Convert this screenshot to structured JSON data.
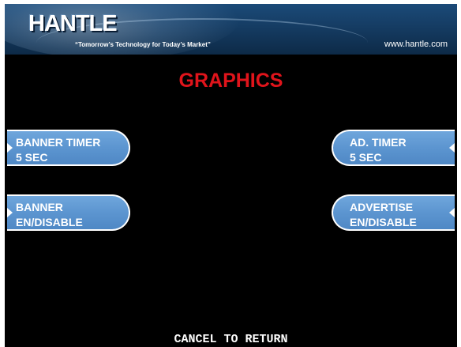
{
  "header": {
    "logo_text": "HANTLE",
    "tagline": "“Tomorrow’s Technology for Today’s Market”",
    "website": "www.hantle.com"
  },
  "screen": {
    "title": "GRAPHICS",
    "footer": "CANCEL TO RETURN"
  },
  "buttons": {
    "banner_timer": {
      "line1": "BANNER TIMER",
      "line2": "5 SEC"
    },
    "banner_enable": {
      "line1": "BANNER",
      "line2": "EN/DISABLE"
    },
    "ad_timer": {
      "line1": "AD. TIMER",
      "line2": "5 SEC"
    },
    "advertise_enable": {
      "line1": "ADVERTISE",
      "line2": "EN/DISABLE"
    }
  },
  "colors": {
    "background": "#000000",
    "title": "#e0141b",
    "button": "#5c95d0",
    "header": "#153c63"
  }
}
